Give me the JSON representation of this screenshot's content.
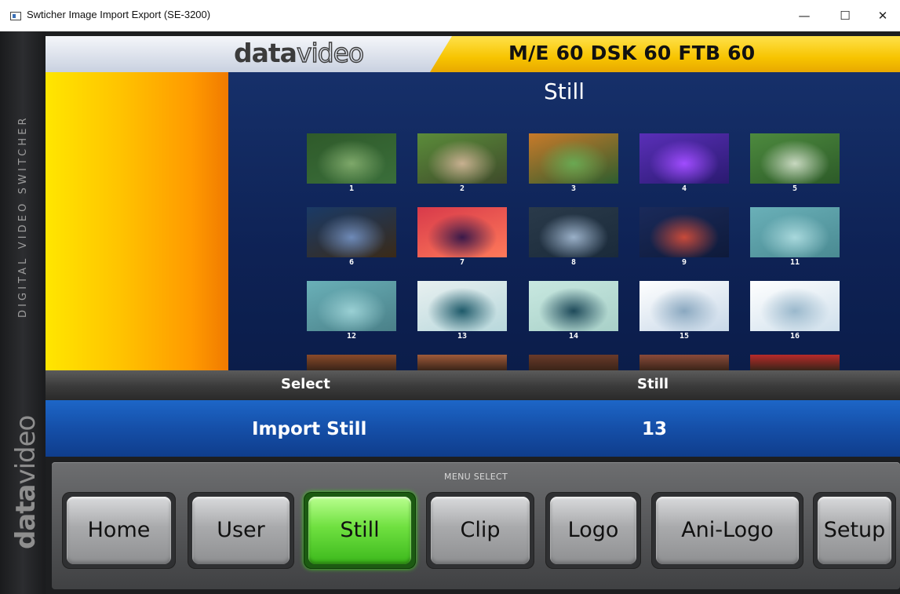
{
  "window": {
    "title": "Swticher Image Import Export (SE-3200)",
    "minimize": "—",
    "maximize": "☐",
    "close": "✕"
  },
  "brand": {
    "logo": "datavideo",
    "logo_part1": "data",
    "logo_part2": "video",
    "vertical_label": "DIGITAL VIDEO SWITCHER",
    "header_info": "M/E 60  DSK 60  FTB 60"
  },
  "still_panel": {
    "title": "Still",
    "thumbnails": [
      {
        "label": "1",
        "colors": [
          "#2f5a2a",
          "#7ea86a",
          "#3a6e3a"
        ]
      },
      {
        "label": "2",
        "colors": [
          "#5b8c3a",
          "#c8b090",
          "#3e4a2a"
        ]
      },
      {
        "label": "3",
        "colors": [
          "#c87a2a",
          "#6aa852",
          "#2e5d2e"
        ]
      },
      {
        "label": "4",
        "colors": [
          "#5a2fb8",
          "#a04cff",
          "#2a1a70"
        ]
      },
      {
        "label": "5",
        "colors": [
          "#4d8a3e",
          "#c8d8c0",
          "#2c5a28"
        ]
      },
      {
        "label": "6",
        "colors": [
          "#1a3a66",
          "#6e8ab8",
          "#3a2a18"
        ]
      },
      {
        "label": "7",
        "colors": [
          "#d83a4a",
          "#3a1a4a",
          "#ff7a5a"
        ]
      },
      {
        "label": "8",
        "colors": [
          "#2a3a4a",
          "#9ab0c8",
          "#1a2a3a"
        ]
      },
      {
        "label": "9",
        "colors": [
          "#1a2a5a",
          "#c84a3a",
          "#0e1a3a"
        ]
      },
      {
        "label": "11",
        "colors": [
          "#6ab0b8",
          "#a8d8dc",
          "#4a8a92"
        ]
      },
      {
        "label": "12",
        "colors": [
          "#6ab0b8",
          "#9ad0d4",
          "#4a8088"
        ]
      },
      {
        "label": "13",
        "colors": [
          "#e8f0f0",
          "#1e5a6a",
          "#b8d8dc"
        ]
      },
      {
        "label": "14",
        "colors": [
          "#c8e8e0",
          "#1e4a5a",
          "#a8d0c8"
        ]
      },
      {
        "label": "15",
        "colors": [
          "#ffffff",
          "#8aa8c0",
          "#c8d8e8"
        ]
      },
      {
        "label": "16",
        "colors": [
          "#ffffff",
          "#9ab8cc",
          "#d0e0ec"
        ]
      }
    ],
    "partial_row_colors": [
      "#8a4a2a",
      "#a05a3a",
      "#6a3a2a",
      "#8a4a3a",
      "#b82a2a"
    ]
  },
  "select_bar": {
    "left": "Select",
    "right": "Still"
  },
  "import_bar": {
    "left": "Import Still",
    "right": "13"
  },
  "menu": {
    "title": "MENU SELECT",
    "buttons": [
      {
        "label": "Home",
        "active": false
      },
      {
        "label": "User",
        "active": false
      },
      {
        "label": "Still",
        "active": true
      },
      {
        "label": "Clip",
        "active": false
      },
      {
        "label": "Logo",
        "active": false
      },
      {
        "label": "Ani-Logo",
        "active": false
      },
      {
        "label": "Setup",
        "active": false
      }
    ]
  }
}
